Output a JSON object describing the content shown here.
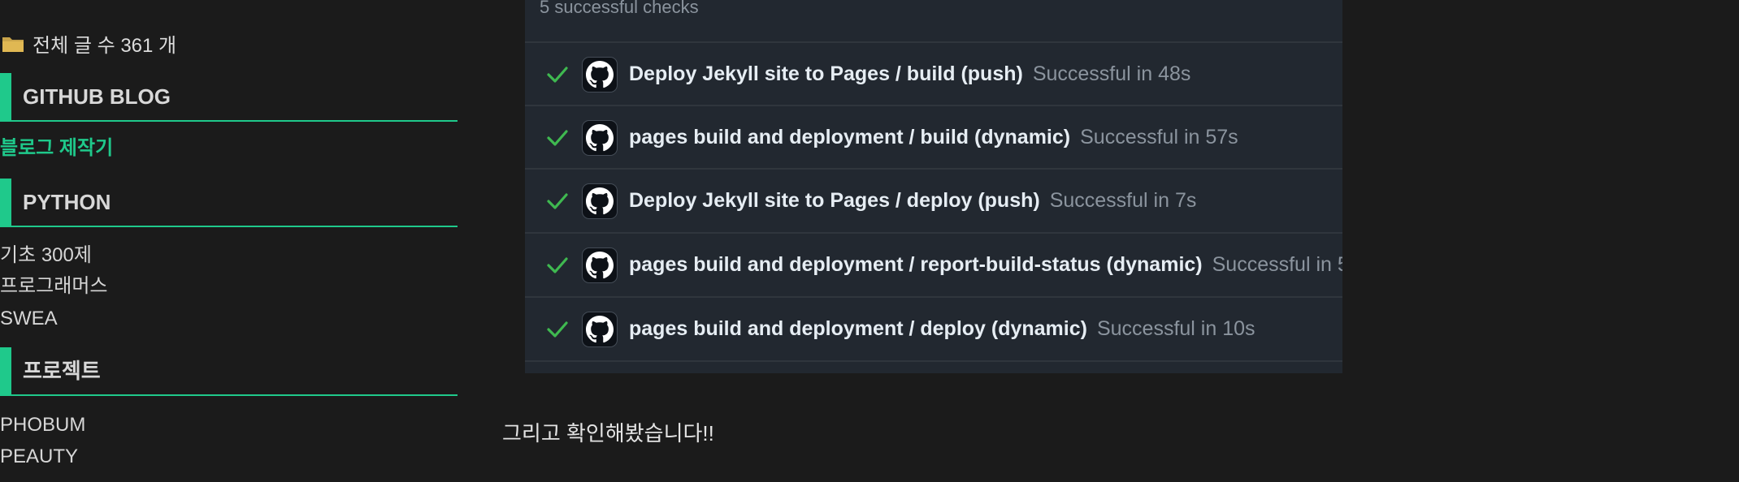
{
  "sidebar": {
    "total_label": "전체 글 수 361 개",
    "categories": [
      {
        "title": "GITHUB BLOG",
        "items": [
          {
            "label": "블로그 제작기",
            "active": true
          }
        ]
      },
      {
        "title": "PYTHON",
        "items": [
          {
            "label": "기초 300제"
          },
          {
            "label": "프로그래머스"
          },
          {
            "label": "SWEA"
          }
        ]
      },
      {
        "title": "프로젝트",
        "items": [
          {
            "label": "PHOBUM"
          },
          {
            "label": "PEAUTY"
          }
        ]
      }
    ]
  },
  "checks_panel": {
    "header": "5 successful checks",
    "rows": [
      {
        "name": "Deploy Jekyll site to Pages / build (push)",
        "status": "Successful in 48s"
      },
      {
        "name": "pages build and deployment / build (dynamic)",
        "status": "Successful in 57s"
      },
      {
        "name": "Deploy Jekyll site to Pages / deploy (push)",
        "status": "Successful in 7s"
      },
      {
        "name": "pages build and deployment / report-build-status (dynamic)",
        "status": "Successful in 5"
      },
      {
        "name": "pages build and deployment / deploy (dynamic)",
        "status": "Successful in 10s"
      }
    ]
  },
  "body_text": "그리고 확인해봤습니다!!",
  "icons": {
    "folder": "folder-icon",
    "check": "check-icon",
    "github": "github-icon"
  },
  "colors": {
    "accent": "#1fc98b",
    "check_green": "#3fb950",
    "background": "#1b1b1b",
    "panel": "#222830"
  }
}
